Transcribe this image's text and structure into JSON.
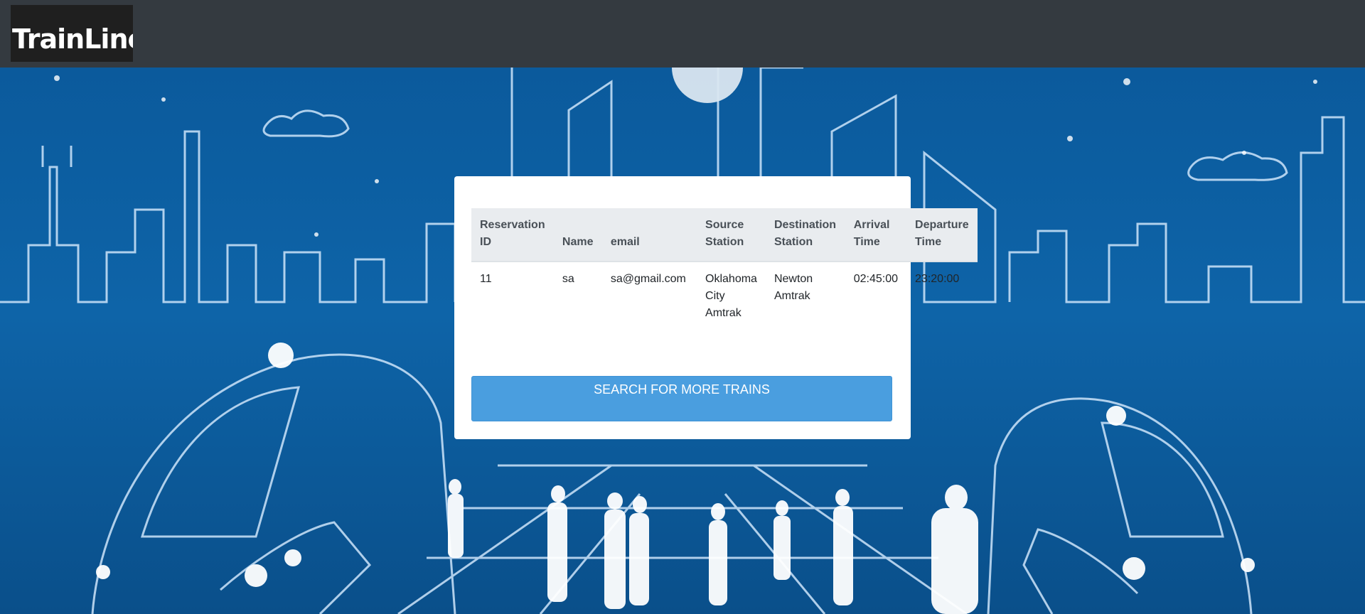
{
  "navbar": {
    "brand": "TrainLine"
  },
  "reservations": {
    "headers": [
      "Reservation ID",
      "Name",
      "email",
      "Source Station",
      "Destination Station",
      "Arrival Time",
      "Departure Time"
    ],
    "rows": [
      [
        "11",
        "sa",
        "sa@gmail.com",
        "Oklahoma City Amtrak",
        "Newton Amtrak",
        "02:45:00",
        "23:20:00"
      ]
    ]
  },
  "actions": {
    "search_more": "SEARCH FOR MORE TRAINS"
  },
  "colors": {
    "navbar": "#343a40",
    "button": "#4a9edf",
    "hero": "#0e64a8"
  }
}
